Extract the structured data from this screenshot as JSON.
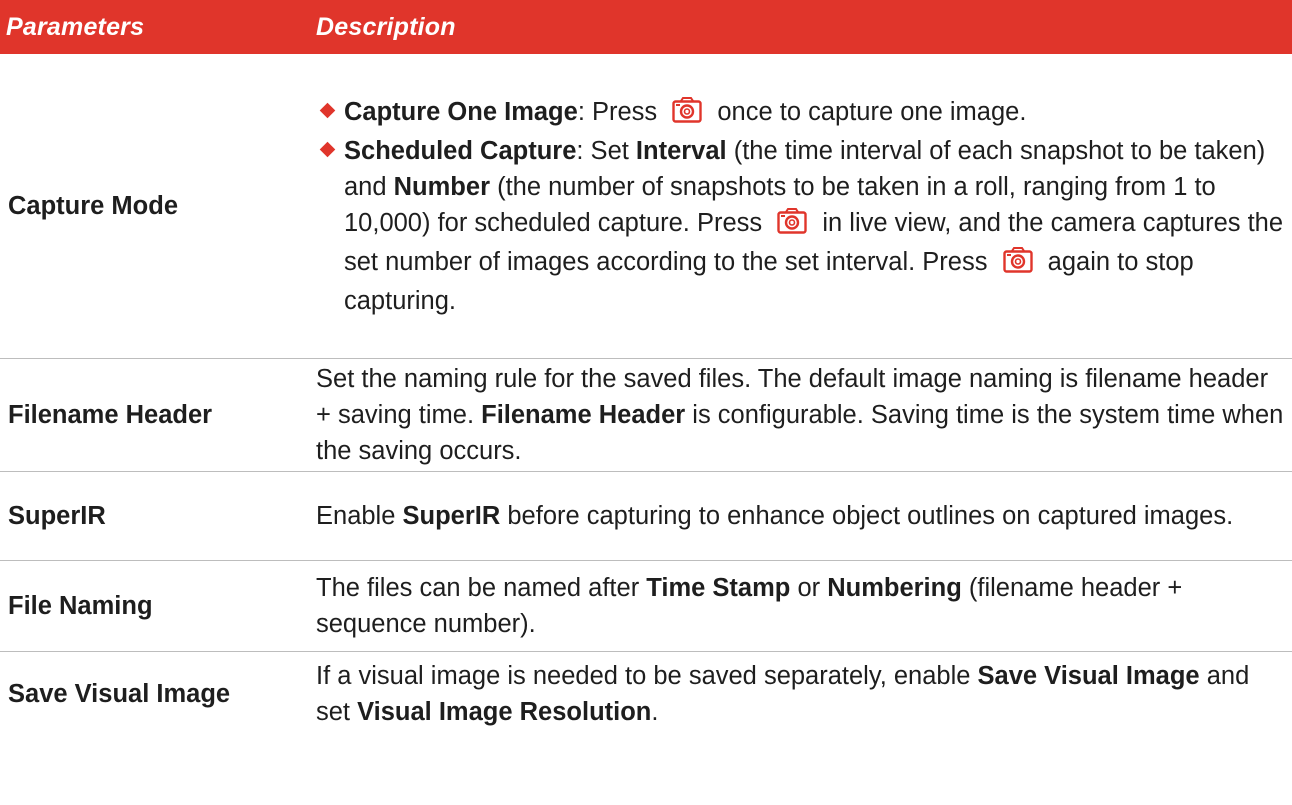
{
  "table": {
    "headers": [
      "Parameters",
      "Description"
    ],
    "header_color": "#e0352b",
    "bullet_color": "#e0352b",
    "rows": [
      {
        "param": "Capture Mode",
        "bullets": [
          {
            "bold": "Capture One Image",
            "t1": ": Press",
            "icon": "camera-icon",
            "t2": "once to capture one image."
          },
          {
            "bold": "Scheduled Capture",
            "t1": ": Set ",
            "bold2": "Interval",
            "t2": " (the time interval of each snapshot to be taken) and ",
            "bold3": "Number",
            "t3": " (the number of snapshots to be taken in a roll, ranging from 1 to 10,000) for scheduled capture. Press",
            "icon": "camera-icon",
            "t4": "in live view, and the camera captures the set number of images according to the set interval. Press",
            "t5": "again to stop capturing."
          }
        ]
      },
      {
        "param": "Filename Header",
        "t1": "Set the naming rule for the saved files. The default image naming is filename header + saving time. ",
        "bold": "Filename Header",
        "t2": " is configurable. Saving time is the system time when the saving occurs."
      },
      {
        "param": "SuperIR",
        "t1": "Enable ",
        "bold": "SuperIR",
        "t2": " before capturing to enhance object outlines on captured images."
      },
      {
        "param": "File Naming",
        "t1": "The files can be named after ",
        "bold": "Time Stamp",
        "t2": " or ",
        "bold2": "Numbering",
        "t3": " (filename header + sequence number)."
      },
      {
        "param": "Save Visual Image",
        "t1": "If a visual image is needed to be saved separately, enable ",
        "bold": "Save Visual Image",
        "t2": " and set ",
        "bold2": "Visual Image Resolution",
        "t3": "."
      }
    ]
  }
}
